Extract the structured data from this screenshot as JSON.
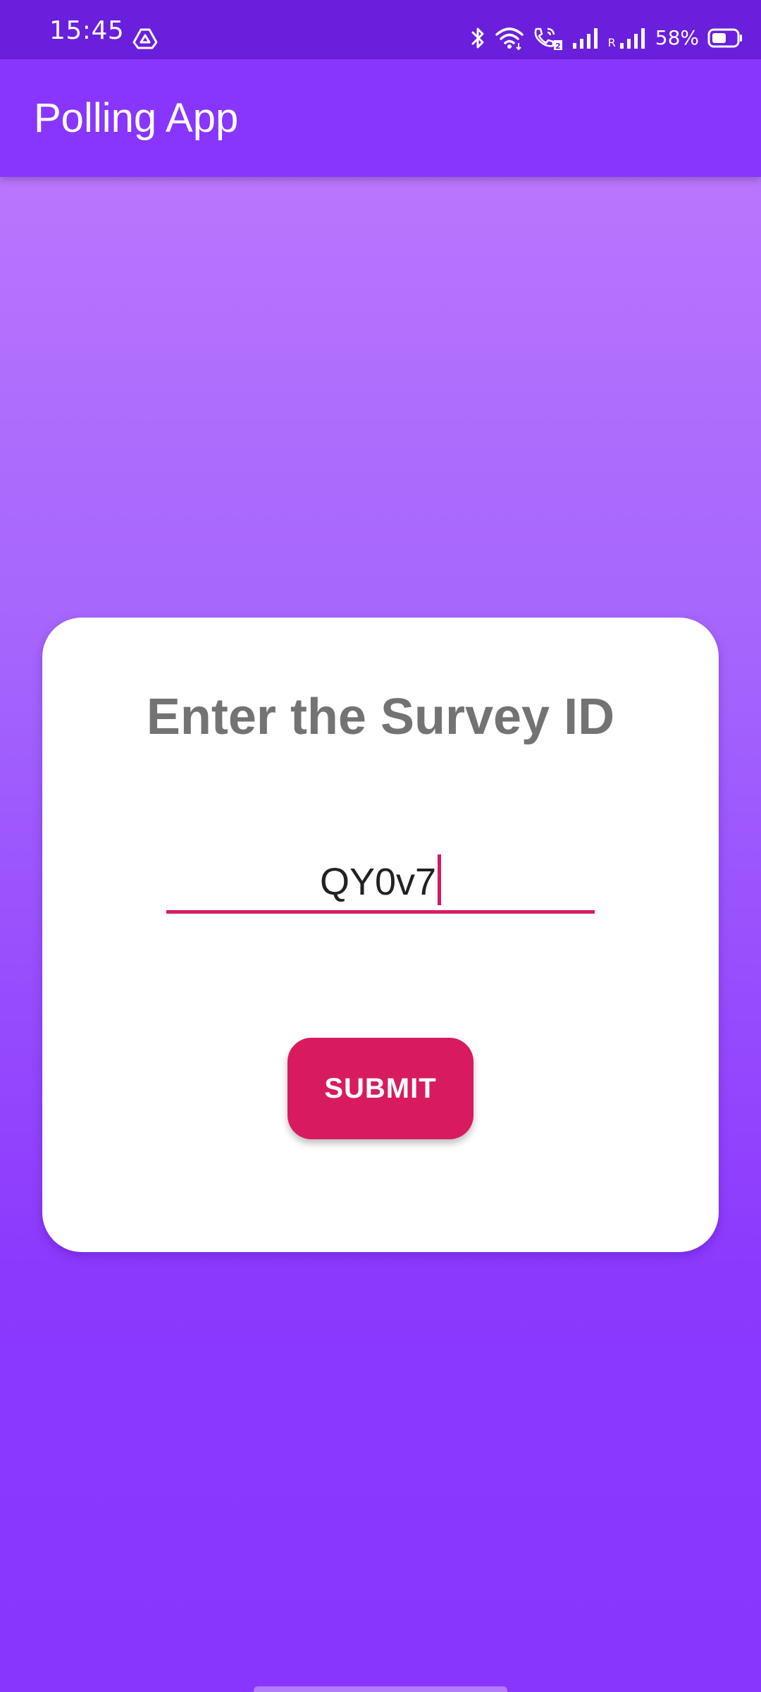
{
  "status_bar": {
    "time": "15:45",
    "battery_percent": "58%",
    "battery_level": 0.58,
    "roaming_indicator": "R",
    "icons": [
      "drive-icon",
      "bluetooth-icon",
      "wifi-icon",
      "wifi-calling-icon",
      "signal-icon",
      "roaming-signal-icon",
      "battery-icon"
    ]
  },
  "app_bar": {
    "title": "Polling App"
  },
  "survey_form": {
    "heading": "Enter the Survey ID",
    "survey_id_value": "QY0v7",
    "submit_label": "SUBMIT"
  },
  "colors": {
    "status_bar": "#6a1fdc",
    "app_bar": "#8836fd",
    "accent": "#d81b60",
    "heading_text": "#737373",
    "card": "#ffffff"
  }
}
